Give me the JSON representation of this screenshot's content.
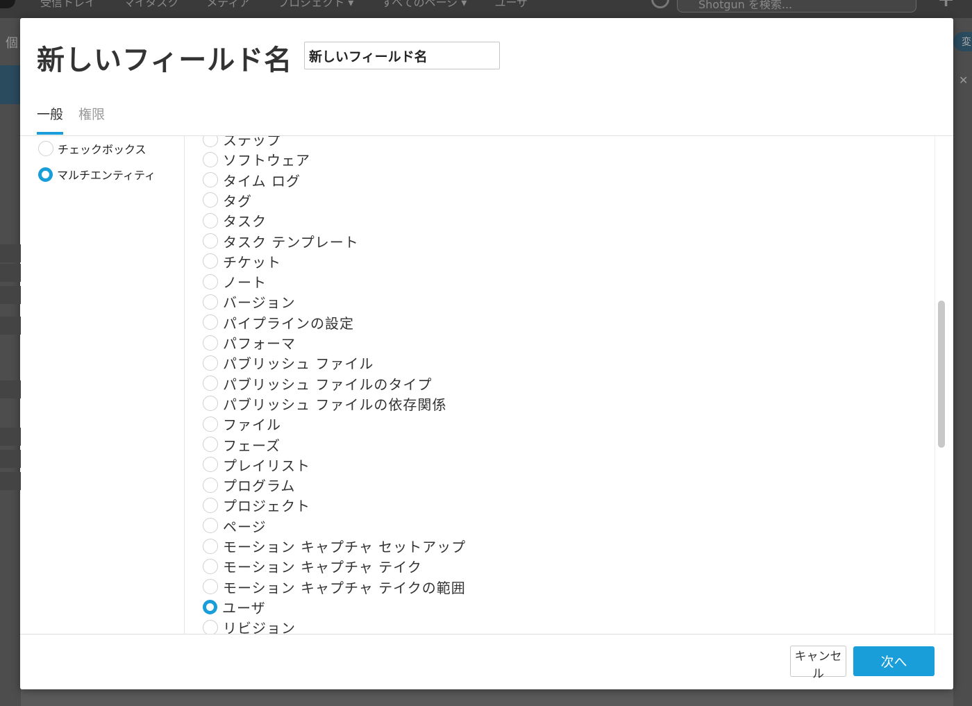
{
  "background": {
    "nav_items": [
      "受信トレイ",
      "マイタスク",
      "メディア",
      "プロジェクト ▾",
      "すべてのページ ▾",
      "ユーザ"
    ],
    "search_placeholder": "Shotgun を検索...",
    "left_char": "個",
    "right_pill": "変",
    "right_x": "✕"
  },
  "modal": {
    "title": "新しいフィールド名",
    "name_input_value": "新しいフィールド名",
    "tabs": [
      {
        "label": "一般",
        "active": true
      },
      {
        "label": "権限",
        "active": false
      }
    ],
    "field_types": [
      {
        "label": "チェックボックス",
        "checked": false
      },
      {
        "label": "マルチエンティティ",
        "checked": true
      }
    ],
    "entities": [
      {
        "label": "ステップ",
        "checked": false
      },
      {
        "label": "ソフトウェア",
        "checked": false
      },
      {
        "label": "タイム ログ",
        "checked": false
      },
      {
        "label": "タグ",
        "checked": false
      },
      {
        "label": "タスク",
        "checked": false
      },
      {
        "label": "タスク テンプレート",
        "checked": false
      },
      {
        "label": "チケット",
        "checked": false
      },
      {
        "label": "ノート",
        "checked": false
      },
      {
        "label": "バージョン",
        "checked": false
      },
      {
        "label": "パイプラインの設定",
        "checked": false
      },
      {
        "label": "パフォーマ",
        "checked": false
      },
      {
        "label": "パブリッシュ ファイル",
        "checked": false
      },
      {
        "label": "パブリッシュ ファイルのタイプ",
        "checked": false
      },
      {
        "label": "パブリッシュ ファイルの依存関係",
        "checked": false
      },
      {
        "label": "ファイル",
        "checked": false
      },
      {
        "label": "フェーズ",
        "checked": false
      },
      {
        "label": "プレイリスト",
        "checked": false
      },
      {
        "label": "プログラム",
        "checked": false
      },
      {
        "label": "プロジェクト",
        "checked": false
      },
      {
        "label": "ページ",
        "checked": false
      },
      {
        "label": "モーション キャプチャ セットアップ",
        "checked": false
      },
      {
        "label": "モーション キャプチャ テイク",
        "checked": false
      },
      {
        "label": "モーション キャプチャ テイクの範囲",
        "checked": false
      },
      {
        "label": "ユーザ",
        "checked": true
      },
      {
        "label": "リビジョン",
        "checked": false
      }
    ],
    "footer": {
      "cancel_label": "キャンセル",
      "next_label": "次へ"
    }
  },
  "colors": {
    "accent": "#1a9ed9",
    "title_text": "#333333",
    "overlay_bg": "#5a5a5a"
  }
}
